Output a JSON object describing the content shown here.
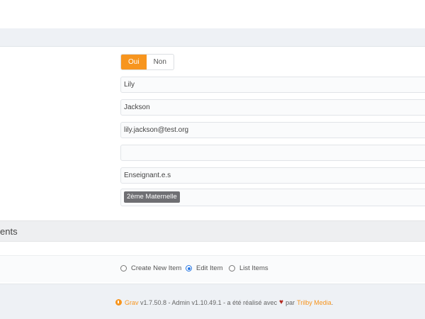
{
  "toggle": {
    "yes_label": "Oui",
    "no_label": "Non"
  },
  "fields": {
    "first_name": "Lily",
    "last_name": "Jackson",
    "email": "lily.jackson@test.org",
    "empty_field": "",
    "role": "Enseignant.e.s",
    "class_tag": "2ème Maternelle"
  },
  "section": {
    "title": "ents"
  },
  "radio_options": [
    {
      "label": "Create New Item",
      "checked": false
    },
    {
      "label": "Edit Item",
      "checked": true
    },
    {
      "label": "List Items",
      "checked": false
    }
  ],
  "footer": {
    "grav_link": "Grav",
    "version_text": " v1.7.50.8 - Admin v1.10.49.1 - a été réalisé avec",
    "par_text": "par",
    "trilby_link": "Trilby Media",
    "period": "."
  },
  "colors": {
    "accent": "#f7951e",
    "tag_bg": "#6f6f73",
    "radio_checked": "#2a79e4",
    "heart": "#b2281e"
  }
}
